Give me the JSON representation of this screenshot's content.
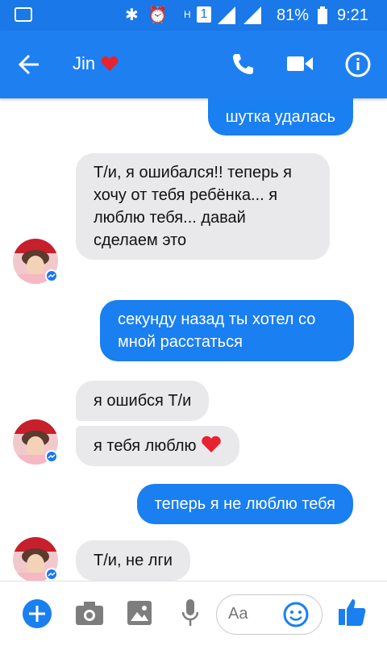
{
  "status_bar": {
    "signal_label": "H",
    "sim_number": "1",
    "battery": "81%",
    "time": "9:21"
  },
  "header": {
    "contact_name": "Jin",
    "accent_color": "#1e7ff0"
  },
  "messages": [
    {
      "side": "out",
      "text": "шутка удалась"
    },
    {
      "side": "in",
      "text": "Т/и, я ошибался!! теперь я хочу от тебя ребёнка... я люблю тебя... давай сделаем это"
    },
    {
      "side": "out",
      "text": "секунду назад ты хотел со мной расстаться"
    },
    {
      "side": "in",
      "text": "я ошибся Т/и"
    },
    {
      "side": "in",
      "text": "я тебя люблю"
    },
    {
      "side": "out",
      "text": "теперь я не люблю тебя"
    },
    {
      "side": "in",
      "text": "Т/и, не лги"
    }
  ],
  "composer": {
    "placeholder": "Aa",
    "icons": [
      "plus-icon",
      "camera-icon",
      "image-icon",
      "mic-icon",
      "emoji-icon",
      "thumbs-up-icon"
    ]
  }
}
